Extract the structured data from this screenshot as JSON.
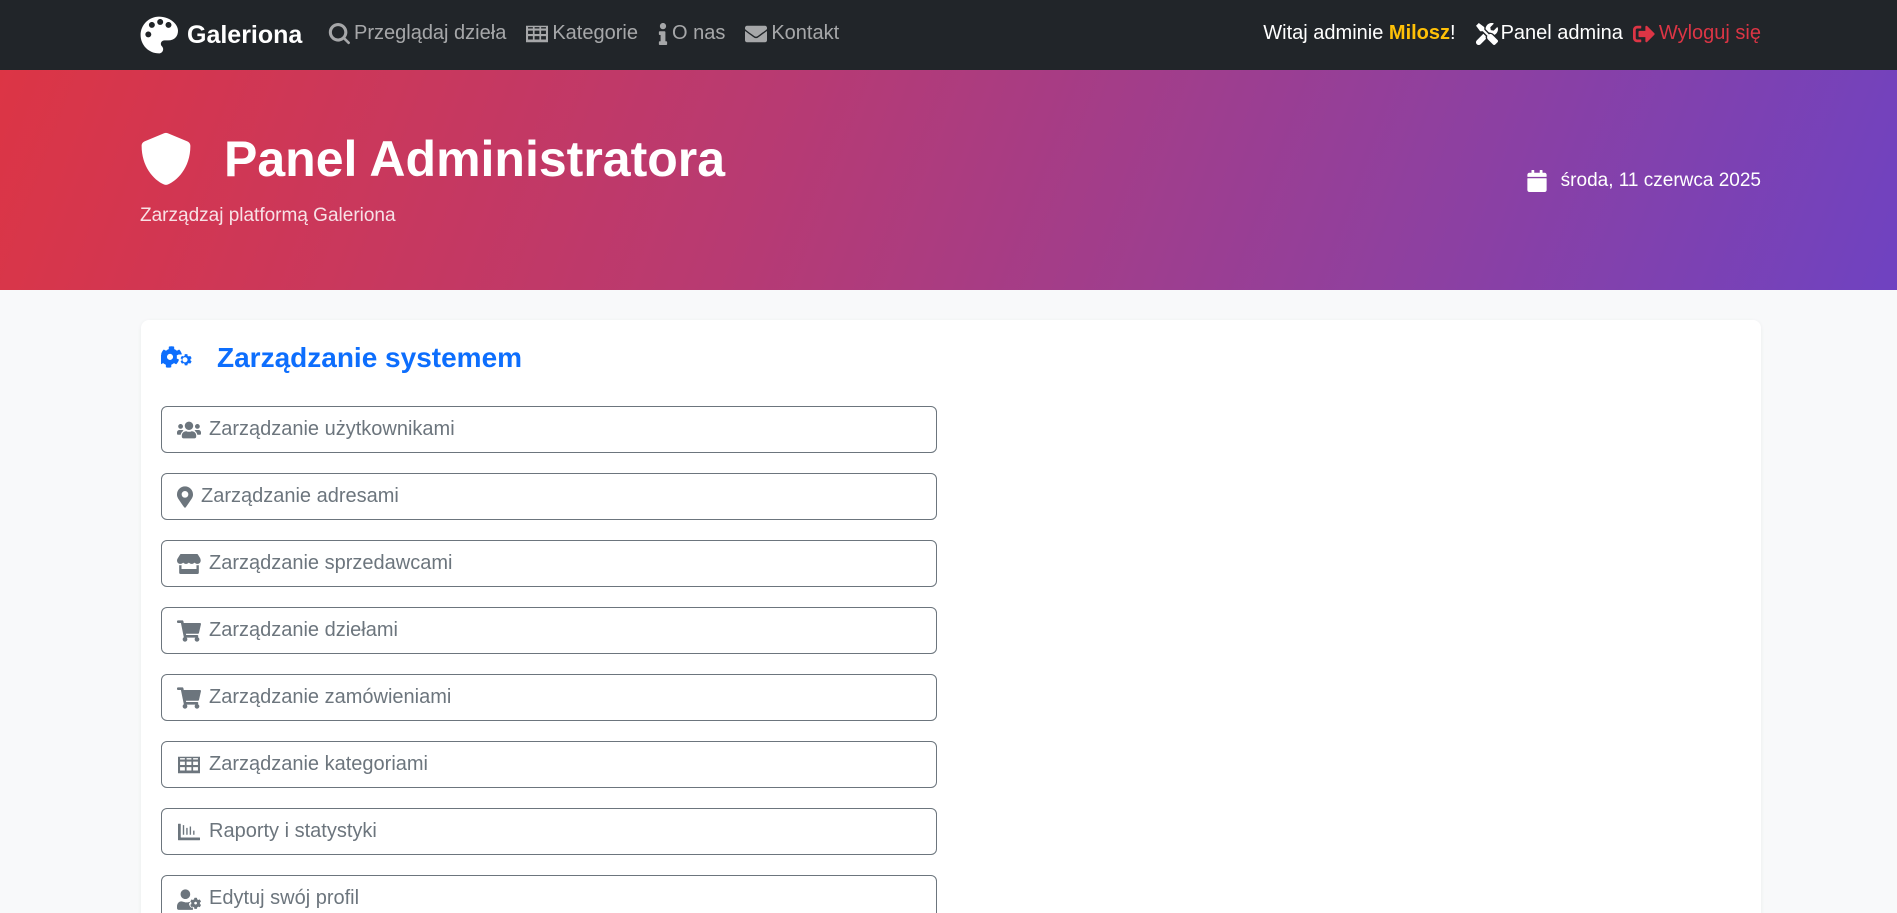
{
  "navbar": {
    "brand": "Galeriona",
    "links": [
      {
        "label": "Przeglądaj dzieła",
        "icon": "search-icon"
      },
      {
        "label": "Kategorie",
        "icon": "grid-icon"
      },
      {
        "label": "O nas",
        "icon": "info-icon"
      },
      {
        "label": "Kontakt",
        "icon": "envelope-icon"
      }
    ],
    "welcome_prefix": "Witaj adminie ",
    "username": "Milosz",
    "welcome_suffix": "!",
    "admin_panel": "Panel admina",
    "logout": "Wyloguj się"
  },
  "hero": {
    "title": "Panel Administratora",
    "subtitle": "Zarządzaj platformą Galeriona",
    "date": "środa, 11 czerwca 2025"
  },
  "card": {
    "title": "Zarządzanie systemem",
    "items": [
      {
        "label": "Zarządzanie użytkownikami",
        "icon": "users-icon"
      },
      {
        "label": "Zarządzanie adresami",
        "icon": "map-pin-icon"
      },
      {
        "label": "Zarządzanie sprzedawcami",
        "icon": "store-icon"
      },
      {
        "label": "Zarządzanie dziełami",
        "icon": "cart-icon"
      },
      {
        "label": "Zarządzanie zamówieniami",
        "icon": "cart-icon"
      },
      {
        "label": "Zarządzanie kategoriami",
        "icon": "table-icon"
      },
      {
        "label": "Raporty i statystyki",
        "icon": "chart-icon"
      },
      {
        "label": "Edytuj swój profil",
        "icon": "user-cog-icon"
      }
    ]
  },
  "colors": {
    "navbar_bg": "#212529",
    "username": "#ffc107",
    "logout": "#dc3545",
    "hero_gradient_start": "#dc3545",
    "hero_gradient_end": "#6f42c1",
    "accent": "#0d6efd",
    "button_outline": "#6c757d"
  }
}
